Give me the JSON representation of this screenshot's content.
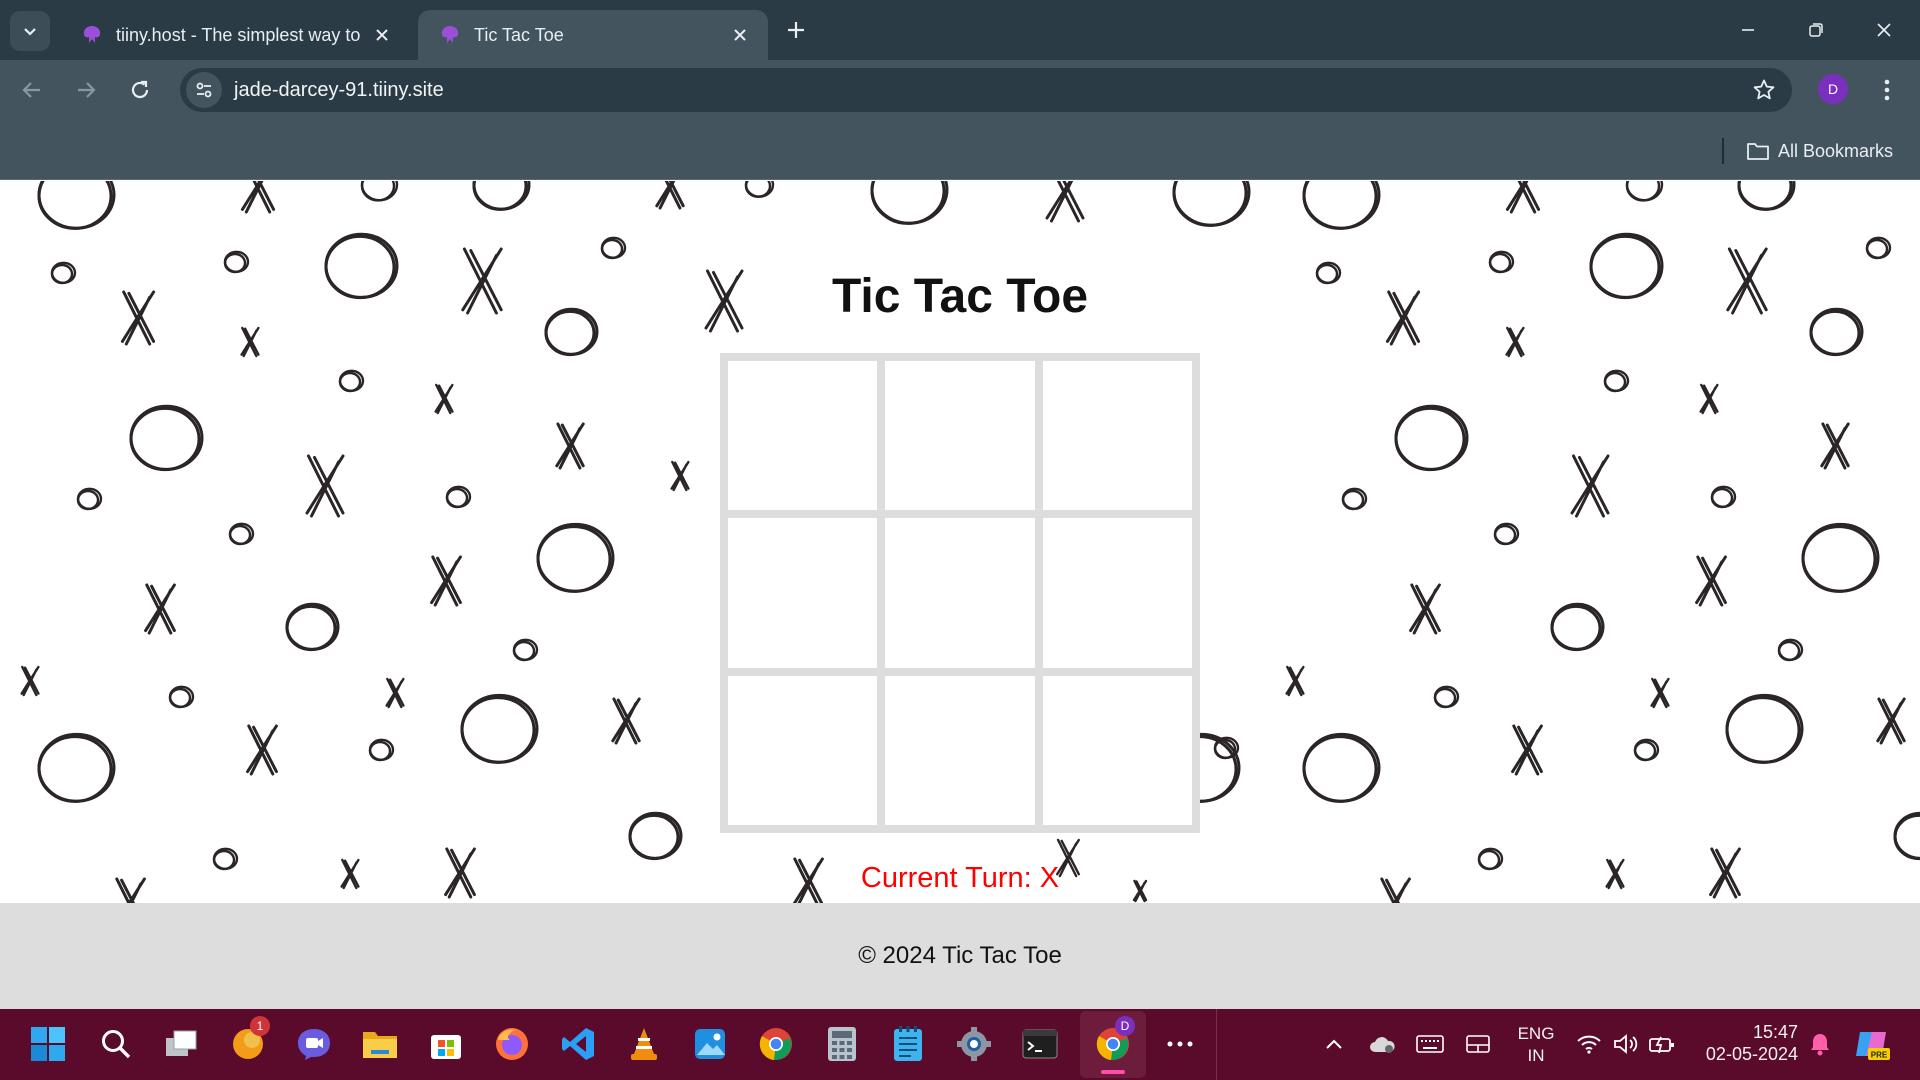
{
  "browser": {
    "tabs": [
      {
        "title": "tiiny.host - The simplest way to",
        "active": false
      },
      {
        "title": "Tic Tac Toe",
        "active": true
      }
    ],
    "url": "jade-darcey-91.tiiny.site",
    "profile_initial": "D",
    "bookmarks_label": "All Bookmarks"
  },
  "page": {
    "title": "Tic Tac Toe",
    "board": [
      "",
      "",
      "",
      "",
      "",
      "",
      "",
      "",
      ""
    ],
    "current_turn_text": "Current Turn: X",
    "footer_text": "© 2024 Tic Tac Toe",
    "colors": {
      "turn": "#ff0000",
      "board_border": "#dddddd",
      "footer_bg": "#dddddd"
    }
  },
  "taskbar": {
    "apps": [
      "start",
      "search",
      "task-view",
      "firefox-nightly",
      "teams-meet",
      "file-explorer",
      "microsoft-store",
      "firefox",
      "vs-code",
      "vlc",
      "photos",
      "chrome",
      "calculator",
      "notepad",
      "settings",
      "terminal",
      "chrome-profile",
      "more"
    ],
    "notification_badge": "1",
    "chrome_badge": "D",
    "lang_top": "ENG",
    "lang_bottom": "IN",
    "time": "15:47",
    "date": "02-05-2024",
    "accent": "#5a0a2a"
  }
}
